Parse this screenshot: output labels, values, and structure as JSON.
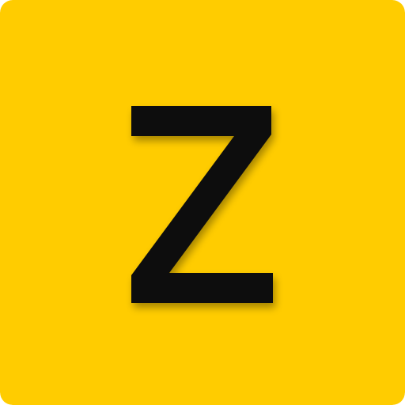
{
  "icon": {
    "letter": "Z",
    "background_color": "#FFCC00",
    "glyph_color": "#0A0A0A",
    "shadow_color": "#000000",
    "semantic": "z-letter-icon"
  }
}
